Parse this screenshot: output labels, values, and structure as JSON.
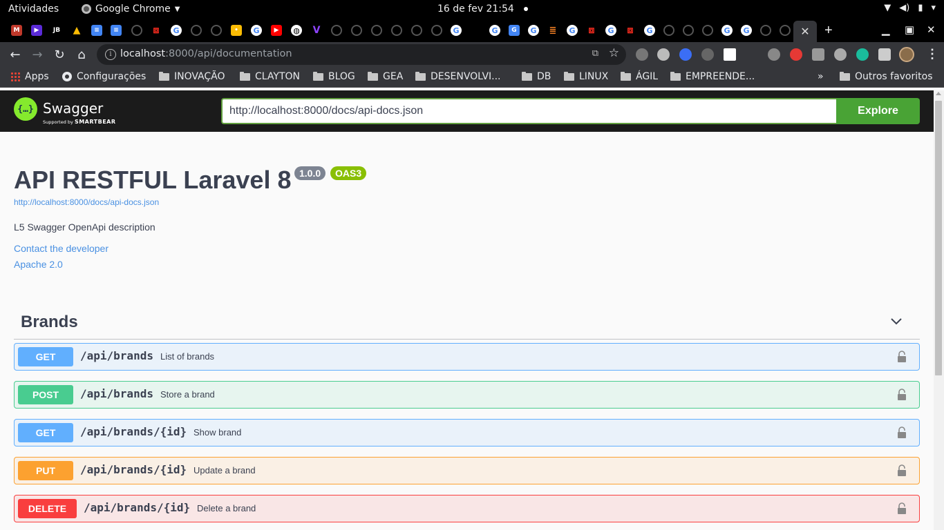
{
  "os_bar": {
    "activities": "Atividades",
    "app_name": "Google Chrome",
    "datetime": "16 de fev  21:54"
  },
  "browser": {
    "url_host": "localhost",
    "url_path": ":8000/api/documentation"
  },
  "bookmarks": [
    {
      "label": "Apps",
      "icon": "apps-grid-icon"
    },
    {
      "label": "Configurações",
      "icon": "gear-icon"
    },
    {
      "label": "INOVAÇÃO",
      "icon": "folder-icon"
    },
    {
      "label": "CLAYTON",
      "icon": "folder-icon"
    },
    {
      "label": "BLOG",
      "icon": "folder-icon"
    },
    {
      "label": "GEA",
      "icon": "folder-icon"
    },
    {
      "label": "DESENVOLVI...",
      "icon": "folder-icon"
    },
    {
      "label": "DB",
      "icon": "folder-icon"
    },
    {
      "label": "LINUX",
      "icon": "folder-icon"
    },
    {
      "label": "ÁGIL",
      "icon": "folder-icon"
    },
    {
      "label": "EMPREENDE...",
      "icon": "folder-icon"
    },
    {
      "label": "Outros favoritos",
      "icon": "folder-icon"
    }
  ],
  "swagger": {
    "logo_text": "Swagger",
    "logo_sub_prefix": "Supported by",
    "logo_sub_brand": "SMARTBEAR",
    "spec_url": "http://localhost:8000/docs/api-docs.json",
    "explore_label": "Explore"
  },
  "info": {
    "title": "API RESTFUL Laravel 8",
    "version": "1.0.0",
    "oas": "OAS3",
    "spec_link": "http://localhost:8000/docs/api-docs.json",
    "description": "L5 Swagger OpenApi description",
    "contact": "Contact the developer",
    "license": "Apache 2.0"
  },
  "tag": {
    "name": "Brands",
    "operations": [
      {
        "method": "GET",
        "path": "/api/brands",
        "summary": "List of brands"
      },
      {
        "method": "POST",
        "path": "/api/brands",
        "summary": "Store a brand"
      },
      {
        "method": "GET",
        "path": "/api/brands/{id}",
        "summary": "Show brand"
      },
      {
        "method": "PUT",
        "path": "/api/brands/{id}",
        "summary": "Update a brand"
      },
      {
        "method": "DELETE",
        "path": "/api/brands/{id}",
        "summary": "Delete a brand"
      }
    ]
  },
  "colors": {
    "get": "#61affe",
    "post": "#49cc90",
    "put": "#fca130",
    "delete": "#f93e3e",
    "swagger_green": "#85ea2d",
    "explore_green": "#49a335"
  }
}
